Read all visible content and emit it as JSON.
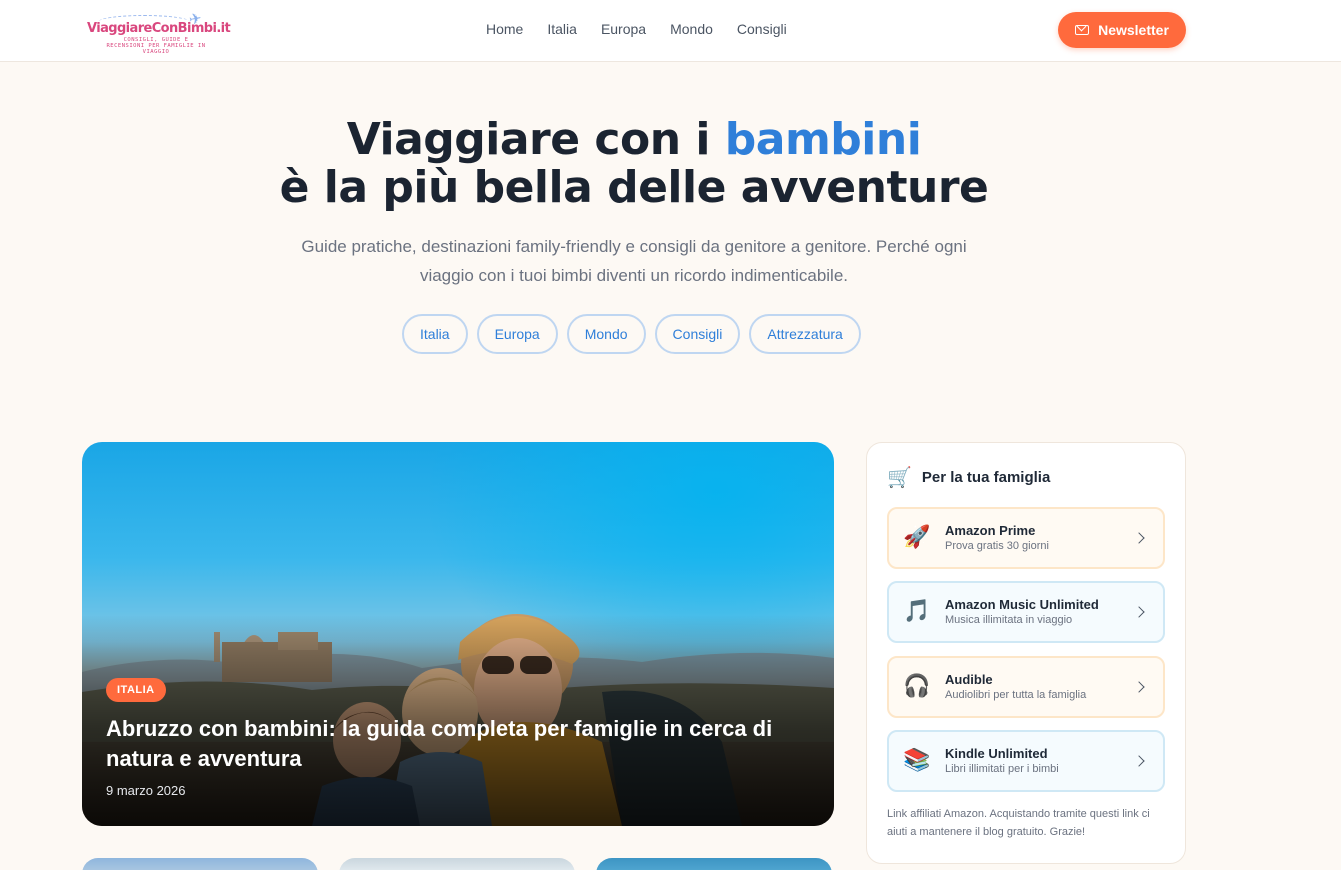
{
  "header": {
    "logo": {
      "main": "ViaggiareConBimbi.it",
      "tagline": "CONSIGLI, GUIDE E RECENSIONI PER FAMIGLIE IN VIAGGIO"
    },
    "nav": [
      "Home",
      "Italia",
      "Europa",
      "Mondo",
      "Consigli"
    ],
    "newsletter_label": "Newsletter"
  },
  "hero": {
    "title_part1": "Viaggiare con i ",
    "title_accent": "bambini",
    "title_line2": "è la più bella delle avventure",
    "subtitle": "Guide pratiche, destinazioni family-friendly e consigli da genitore a genitore. Perché ogni viaggio con i tuoi bimbi diventi un ricordo indimenticabile.",
    "categories": [
      "Italia",
      "Europa",
      "Mondo",
      "Consigli",
      "Attrezzatura"
    ]
  },
  "featured": {
    "tag": "ITALIA",
    "title": "Abruzzo con bambini: la guida completa per famiglie in cerca di natura e avventura",
    "date": "9 marzo 2026"
  },
  "sidebar": {
    "title": "Per la tua famiglia",
    "offers": [
      {
        "name": "Amazon Prime",
        "desc": "Prova gratis 30 giorni",
        "icon": "rocket-icon"
      },
      {
        "name": "Amazon Music Unlimited",
        "desc": "Musica illimitata in viaggio",
        "icon": "music-note-icon"
      },
      {
        "name": "Audible",
        "desc": "Audiolibri per tutta la famiglia",
        "icon": "headphones-icon"
      },
      {
        "name": "Kindle Unlimited",
        "desc": "Libri illimitati per i bimbi",
        "icon": "books-icon"
      }
    ],
    "note": "Link affiliati Amazon. Acquistando tramite questi link ci aiuti a mantenere il blog gratuito. Grazie!"
  },
  "colors": {
    "accent": "#ff6a3d",
    "link_blue": "#2f7fd9",
    "background": "#fdf9f4"
  }
}
